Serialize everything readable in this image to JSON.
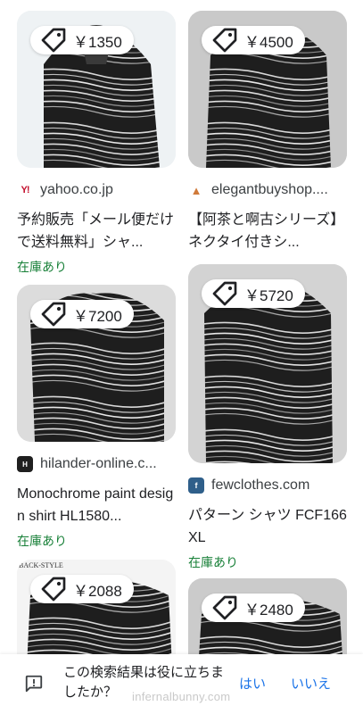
{
  "results": {
    "left": [
      {
        "price": "￥1350",
        "source": "yahoo.co.jp",
        "favicon_text": "Y!",
        "title": "予約販売「メール便だけで送料無料」シャ...",
        "stock": "在庫あり"
      },
      {
        "price": "￥7200",
        "source": "hilander-online.c...",
        "favicon_text": "H",
        "title": "Monochrome paint design shirt HL1580...",
        "stock": "在庫あり"
      },
      {
        "price": "￥2088",
        "image_caption": "BACK-STYLE"
      }
    ],
    "right": [
      {
        "price": "￥4500",
        "source": "elegantbuyshop....",
        "favicon_text": "▲",
        "title": "【阿茶と啊古シリーズ】 ネクタイ付きシ...",
        "stock": ""
      },
      {
        "price": "￥5720",
        "source": "fewclothes.com",
        "favicon_text": "f",
        "title": "パターン シャツ FCF166 XL",
        "stock": "在庫あり"
      },
      {
        "price": "￥2480"
      }
    ]
  },
  "feedback": {
    "question": "この検索結果は役に立ちましたか？",
    "yes_label": "はい",
    "no_label": "いいえ",
    "icon": "feedback-icon"
  },
  "watermark": "infernalbunny.com",
  "colors": {
    "stock_green": "#188038",
    "link_blue": "#1a73e8",
    "text": "#202124",
    "secondary_text": "#3c4043"
  }
}
